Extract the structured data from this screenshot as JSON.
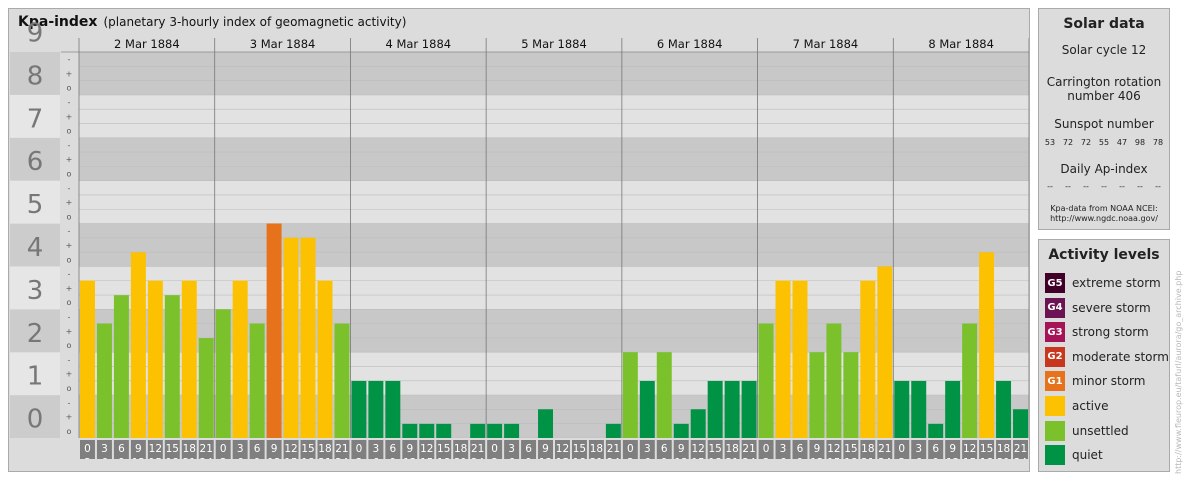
{
  "header": {
    "title": "Kpa-index",
    "subtitle": "(planetary 3-hourly index of geomagnetic activity)"
  },
  "chart_data": {
    "type": "bar",
    "title": "Kpa-index",
    "subtitle": "(planetary 3-hourly index of geomagnetic activity)",
    "ylim": [
      0,
      9
    ],
    "y_ticks": [
      "0",
      "1",
      "2",
      "3",
      "4",
      "5",
      "6",
      "7",
      "8",
      "9"
    ],
    "sub_ticks": [
      "o",
      "+",
      "-"
    ],
    "days": [
      "2 Mar 1884",
      "3 Mar 1884",
      "4 Mar 1884",
      "5 Mar 1884",
      "6 Mar 1884",
      "7 Mar 1884",
      "8 Mar 1884"
    ],
    "interval_start": [
      "0",
      "3",
      "6",
      "9",
      "12",
      "15",
      "18",
      "21"
    ],
    "interval_end": [
      "3",
      "6",
      "9",
      "12",
      "15",
      "18",
      "21",
      "24"
    ],
    "values": [
      [
        3.67,
        2.67,
        3.33,
        4.33,
        3.67,
        3.33,
        3.67,
        2.33
      ],
      [
        3.0,
        3.67,
        2.67,
        5.0,
        4.67,
        4.67,
        3.67,
        2.67
      ],
      [
        1.33,
        1.33,
        1.33,
        0.33,
        0.33,
        0.33,
        0.0,
        0.33
      ],
      [
        0.33,
        0.33,
        0.0,
        0.67,
        0.0,
        0.0,
        0.0,
        0.33
      ],
      [
        2.0,
        1.33,
        2.0,
        0.33,
        0.67,
        1.33,
        1.33,
        1.33
      ],
      [
        2.67,
        3.67,
        3.67,
        2.0,
        2.67,
        2.0,
        3.67,
        4.0
      ],
      [
        1.33,
        1.33,
        0.33,
        1.33,
        2.67,
        4.33,
        1.33,
        0.67
      ]
    ],
    "level_colors": {
      "quiet": "#009245",
      "unsettled": "#7ac12c",
      "active": "#fcc100",
      "G1": "#e6721b",
      "G2": "#c8361e",
      "G3": "#a51457",
      "G4": "#6c1353",
      "G5": "#400027"
    }
  },
  "solar": {
    "title": "Solar data",
    "cycle": "Solar cycle 12",
    "carrington_1": "Carrington rotation",
    "carrington_2": "number 406",
    "sunspot_title": "Sunspot number",
    "sunspots": [
      "53",
      "72",
      "72",
      "55",
      "47",
      "98",
      "78"
    ],
    "ap_title": "Daily Ap-index",
    "ap_values": [
      "--",
      "--",
      "--",
      "--",
      "--",
      "--",
      "--"
    ],
    "source_1": "Kpa-data from NOAA NCEI:",
    "source_2": "http://www.ngdc.noaa.gov/"
  },
  "activity": {
    "title": "Activity levels",
    "items": [
      {
        "badge": "G5",
        "label": "extreme storm",
        "color": "#400027"
      },
      {
        "badge": "G4",
        "label": "severe storm",
        "color": "#6c1353"
      },
      {
        "badge": "G3",
        "label": "strong storm",
        "color": "#a51457"
      },
      {
        "badge": "G2",
        "label": "moderate storm",
        "color": "#c8361e"
      },
      {
        "badge": "G1",
        "label": "minor storm",
        "color": "#e6721b"
      },
      {
        "badge": "",
        "label": "active",
        "color": "#fcc100"
      },
      {
        "badge": "",
        "label": "unsettled",
        "color": "#7ac12c"
      },
      {
        "badge": "",
        "label": "quiet",
        "color": "#009245"
      }
    ]
  },
  "credit": "http://www.fleurop.eu/tafurl/aurora/go_archive.php"
}
